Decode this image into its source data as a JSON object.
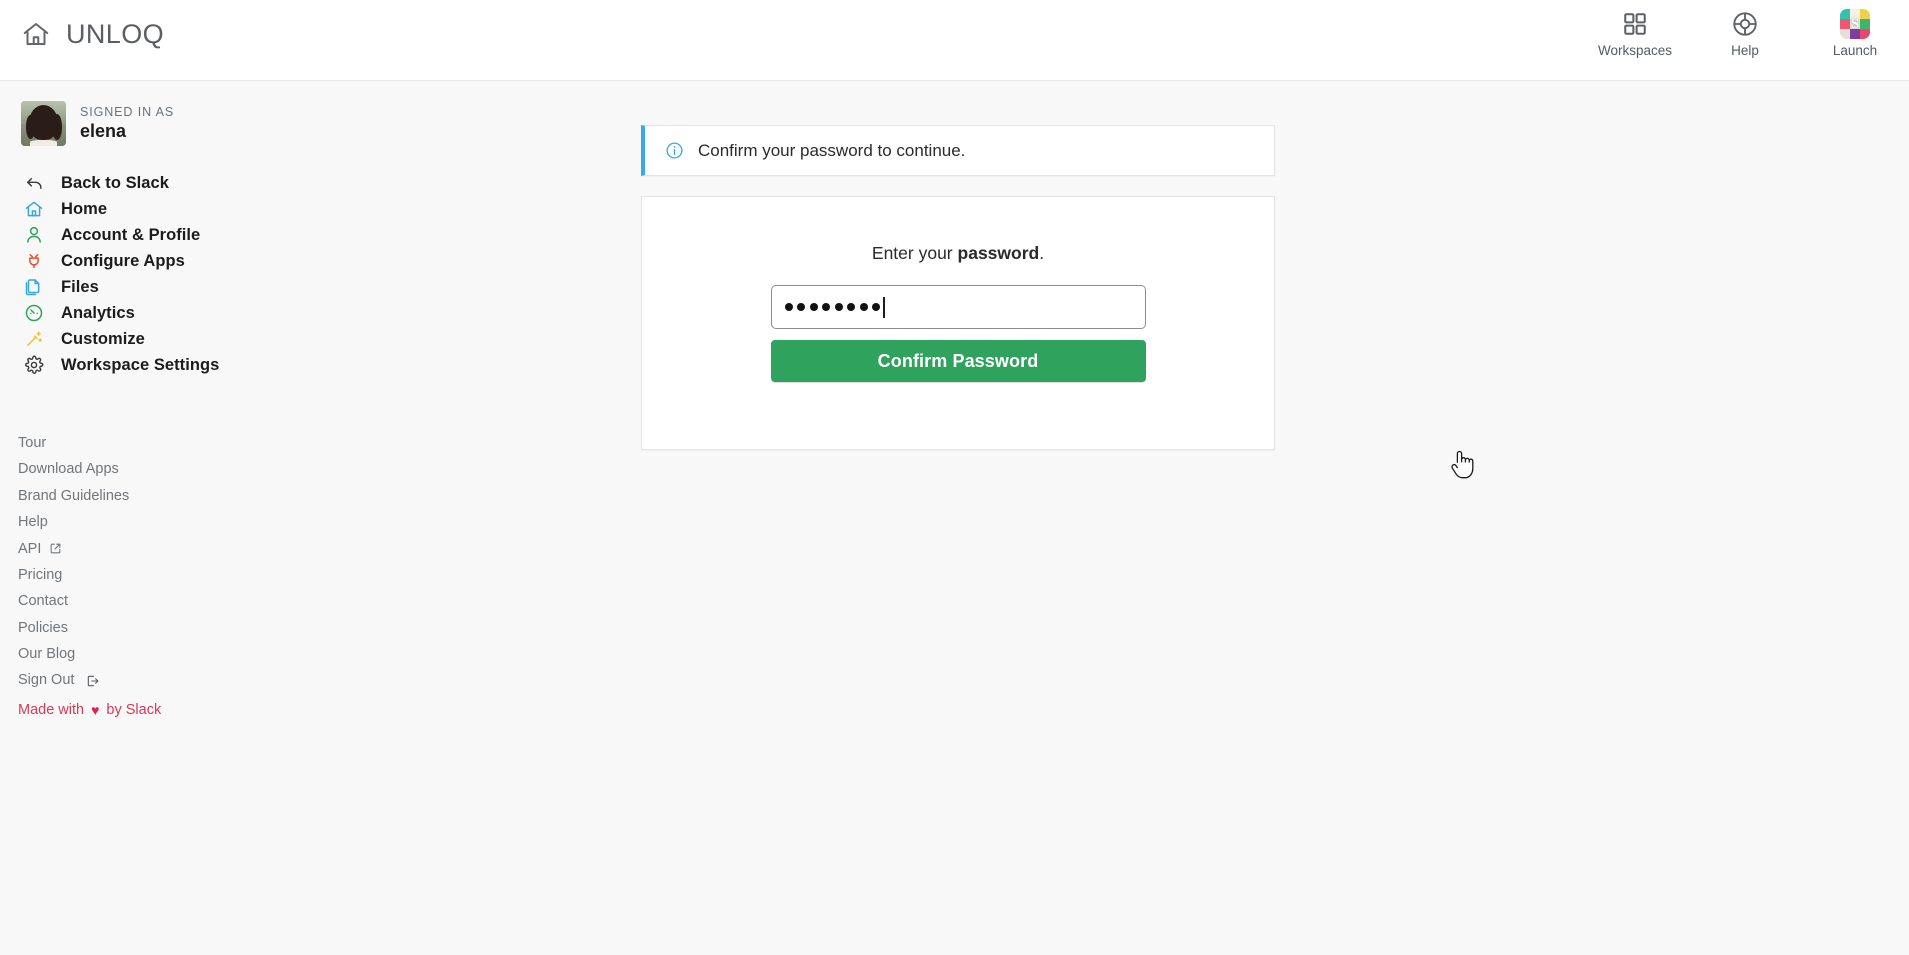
{
  "header": {
    "brand_icon": "home-icon",
    "brand_name": "UNLOQ",
    "actions": [
      {
        "icon": "grid-icon",
        "label": "Workspaces"
      },
      {
        "icon": "lifebuoy-icon",
        "label": "Help"
      },
      {
        "icon": "slack-app-icon",
        "label": "Launch",
        "glyph": "S"
      }
    ]
  },
  "sidebar": {
    "signed_in_caption": "SIGNED IN AS",
    "username": "elena",
    "avatar_alt": "elena-avatar",
    "nav": [
      {
        "icon": "back-arrow-icon",
        "label": "Back to Slack",
        "color": "#3a3a3a"
      },
      {
        "icon": "home-icon",
        "label": "Home",
        "color": "#36a6e0"
      },
      {
        "icon": "person-icon",
        "label": "Account & Profile",
        "color": "#2fa35e"
      },
      {
        "icon": "plug-icon",
        "label": "Configure Apps",
        "color": "#e8512f"
      },
      {
        "icon": "files-icon",
        "label": "Files",
        "color": "#36a6e0"
      },
      {
        "icon": "gauge-icon",
        "label": "Analytics",
        "color": "#2fa35e"
      },
      {
        "icon": "magic-wand-icon",
        "label": "Customize",
        "color": "#f0c23b"
      },
      {
        "icon": "gear-icon",
        "label": "Workspace Settings",
        "color": "#3a3a3a"
      }
    ],
    "footer_links": [
      {
        "label": "Tour"
      },
      {
        "label": "Download Apps"
      },
      {
        "label": "Brand Guidelines"
      },
      {
        "label": "Help"
      },
      {
        "label": "API",
        "icon": "external-link-icon"
      },
      {
        "label": "Pricing"
      },
      {
        "label": "Contact"
      },
      {
        "label": "Policies"
      },
      {
        "label": "Our Blog"
      },
      {
        "label": "Sign Out",
        "icon": "sign-out-icon"
      }
    ],
    "made_with_prefix": "Made with",
    "made_with_suffix": "by Slack",
    "heart_glyph": "♥"
  },
  "main": {
    "alert": {
      "icon": "info-circle-icon",
      "text": "Confirm your password to continue.",
      "accent_color": "#36a9e6"
    },
    "form": {
      "title_prefix": "Enter your ",
      "title_strong": "password",
      "title_suffix": ".",
      "password_value": "••••••••",
      "password_char_count": 8,
      "password_placeholder": "",
      "submit_label": "Confirm Password",
      "submit_color": "#2fa35e"
    }
  },
  "colors": {
    "page_background": "#f8f8f8",
    "header_background": "#ffffff",
    "card_background": "#ffffff",
    "text_primary": "#1d1c1d",
    "text_muted": "#71767a",
    "brand_red": "#d7395a"
  }
}
